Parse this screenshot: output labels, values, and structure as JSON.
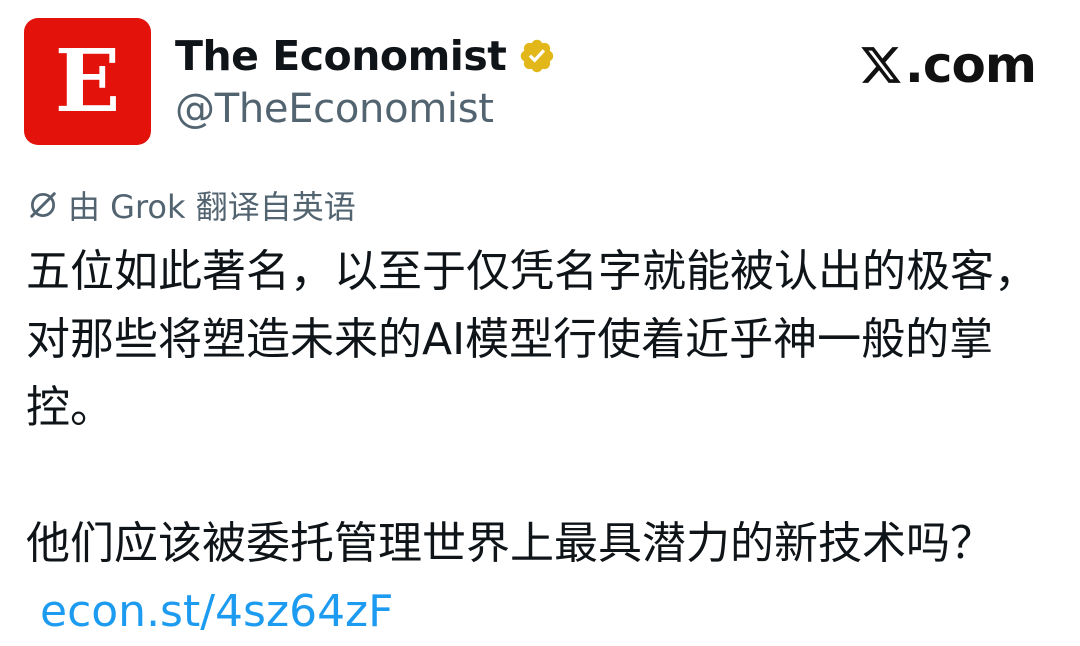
{
  "author": {
    "avatar_letter": "E",
    "display_name": "The Economist",
    "handle": "@TheEconomist",
    "verified_color": "#e2b719",
    "avatar_color": "#e3120b"
  },
  "brand": {
    "site": ".com"
  },
  "translation": {
    "label": "由 Grok 翻译自英语"
  },
  "tweet": {
    "paragraph1": "五位如此著名，以至于仅凭名字就能被认出的极客，对那些将塑造未来的AI模型行使着近乎神一般的掌控。",
    "paragraph2": "他们应该被委托管理世界上最具潜力的新技术吗？",
    "link_text": "econ.st/4sz64zF",
    "link_color": "#1d9bf0"
  }
}
